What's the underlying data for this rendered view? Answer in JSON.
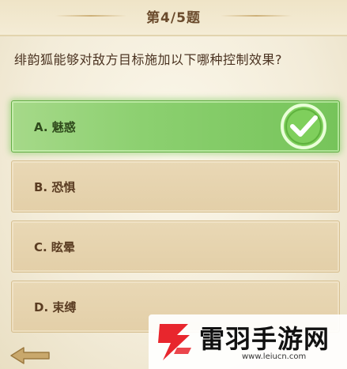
{
  "header": {
    "title": "第4/5题"
  },
  "question": {
    "text": "绯韵狐能够对敌方目标施加以下哪种控制效果?"
  },
  "options": [
    {
      "label": "A. 魅惑",
      "state": "correct"
    },
    {
      "label": "B. 恐惧",
      "state": "normal"
    },
    {
      "label": "C. 眩晕",
      "state": "normal"
    },
    {
      "label": "D. 束缚",
      "state": "normal"
    }
  ],
  "icons": {
    "correct_mark": "check-circle-icon",
    "back": "arrow-left-icon"
  },
  "colors": {
    "correct_green": "#8cd070",
    "option_bg": "#e6d3ad",
    "text_brown": "#5a3c22",
    "watermark_red": "#e8262d"
  },
  "watermark": {
    "name": "雷羽手游网",
    "url": "www.leiucn.com"
  }
}
